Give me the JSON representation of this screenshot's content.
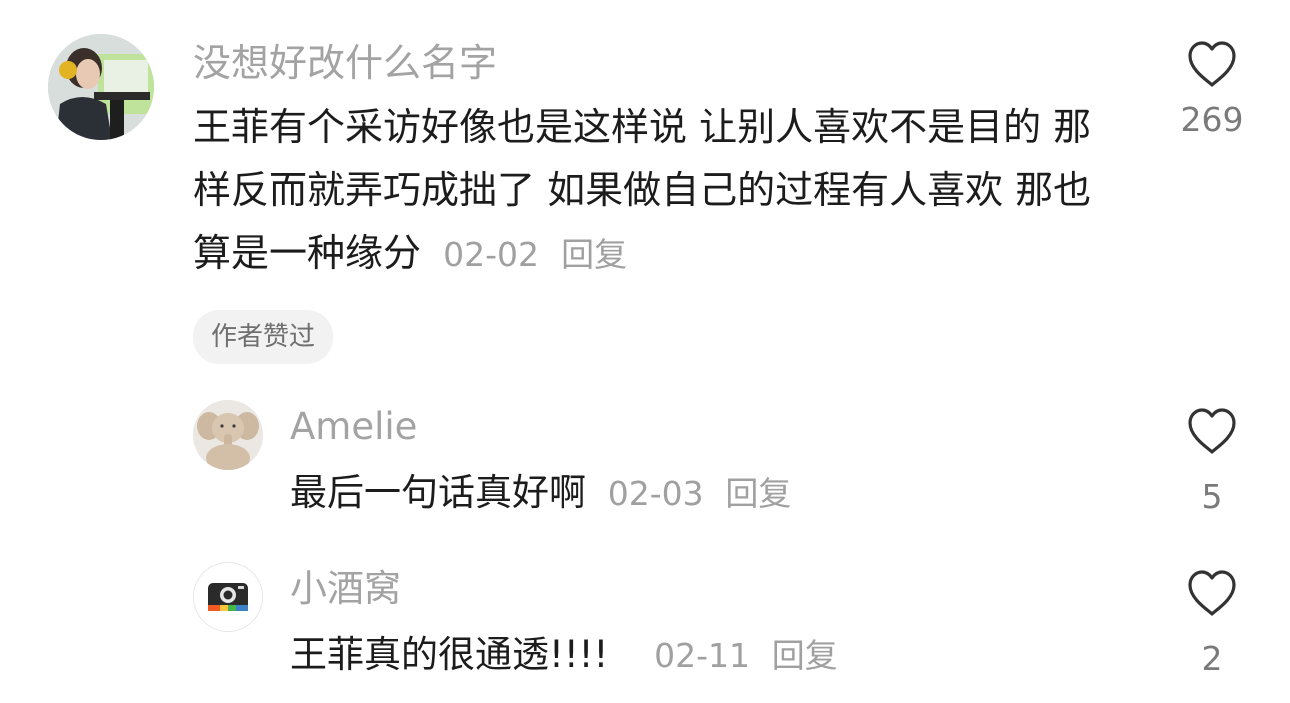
{
  "comments": [
    {
      "username": "没想好改什么名字",
      "text": "王菲有个采访好像也是这样说 让别人喜欢不是目的 那样反而就弄巧成拙了 如果做自己的过程有人喜欢 那也算是一种缘分",
      "date": "02-02",
      "reply_label": "回复",
      "like_count": "269",
      "badge": "作者赞过",
      "avatar_icon": "avatar-photo-shooter-icon"
    }
  ],
  "replies": [
    {
      "username": "Amelie",
      "text": "最后一句话真好啊",
      "date": "02-03",
      "reply_label": "回复",
      "like_count": "5",
      "avatar_icon": "avatar-elephant-plush-icon"
    },
    {
      "username": "小酒窝",
      "text": "王菲真的很通透!!!!",
      "date": "02-11",
      "reply_label": "回复",
      "like_count": "2",
      "avatar_icon": "avatar-camera-icon"
    }
  ],
  "colors": {
    "username": "#a3a3a3",
    "text": "#1c1c1c",
    "meta": "#a0a0a0",
    "badge_bg": "#f2f2f2",
    "heart_stroke": "#333333"
  }
}
